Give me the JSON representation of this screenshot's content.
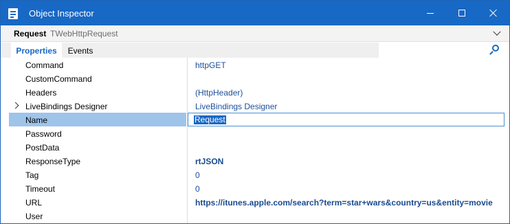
{
  "window": {
    "title": "Object Inspector",
    "icon": "object-inspector-icon"
  },
  "selector": {
    "component_name": "Request",
    "component_type": "TWebHttpRequest"
  },
  "tabs": [
    {
      "label": "Properties",
      "active": true
    },
    {
      "label": "Events",
      "active": false
    }
  ],
  "properties": [
    {
      "name": "Command",
      "value": "httpGET",
      "bold": false
    },
    {
      "name": "CustomCommand",
      "value": "",
      "bold": false
    },
    {
      "name": "Headers",
      "value": "(HttpHeader)",
      "bold": false
    },
    {
      "name": "LiveBindings Designer",
      "value": "LiveBindings Designer",
      "bold": false,
      "expandable": true
    },
    {
      "name": "Name",
      "value": "Request",
      "bold": false,
      "selected": true
    },
    {
      "name": "Password",
      "value": "",
      "bold": false
    },
    {
      "name": "PostData",
      "value": "",
      "bold": false
    },
    {
      "name": "ResponseType",
      "value": "rtJSON",
      "bold": true
    },
    {
      "name": "Tag",
      "value": "0",
      "bold": false
    },
    {
      "name": "Timeout",
      "value": "0",
      "bold": false
    },
    {
      "name": "URL",
      "value": "https://itunes.apple.com/search?term=star+wars&country=us&entity=movie",
      "bold": true
    },
    {
      "name": "User",
      "value": "",
      "bold": false
    }
  ],
  "colors": {
    "titlebar": "#1868c5",
    "selection": "#9ec4ea",
    "value_text": "#1c4f9a"
  }
}
